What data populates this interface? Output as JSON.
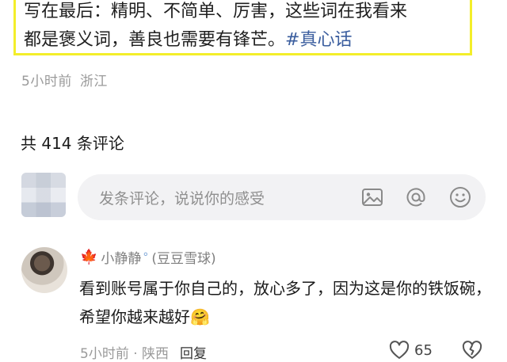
{
  "post": {
    "text_line1": "写在最后：精明、不简单、厉害，这些词在我看来",
    "text_line2_prefix": "都是褒义词，善良也需要有锋芒。",
    "hashtag": "#真心话",
    "time": "5小时前",
    "location": "浙江"
  },
  "comments_section": {
    "count_label": "共 414 条评论",
    "input_placeholder": "发条评论，说说你的感受",
    "icons": [
      "image-icon",
      "mention-icon",
      "emoji-icon"
    ]
  },
  "comment": {
    "author_prefix_emoji": "🍁",
    "author_name": "小静静",
    "author_suffix_emoji": "°",
    "author_note": "(豆豆雪球)",
    "body": "看到账号属于你自己的，放心多了，因为这是你的铁饭碗，希望你越来越好",
    "body_emoji": "🤗",
    "time_location": "5小时前 · 陕西",
    "reply_label": "回复",
    "like_count": "65"
  },
  "colors": {
    "highlight_border": "#f3ee2a",
    "hashtag": "#3a5d9e",
    "input_bg": "#f2f2f4",
    "meta_text": "#9a9a9a"
  }
}
